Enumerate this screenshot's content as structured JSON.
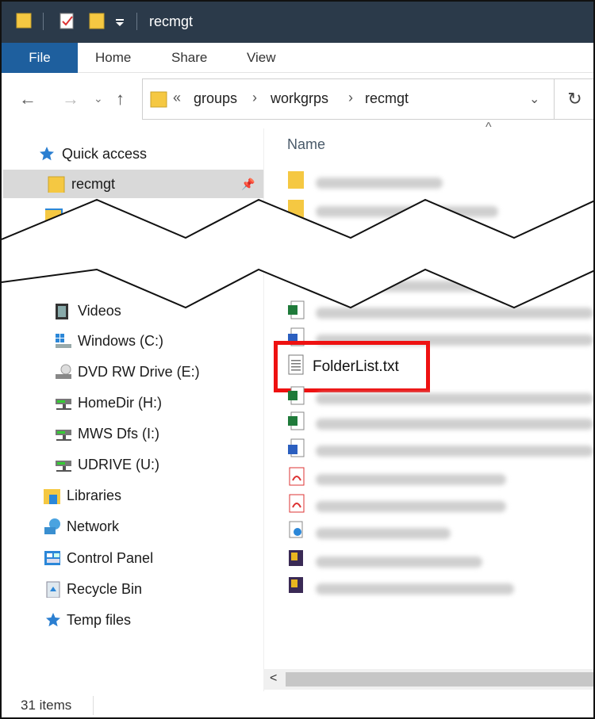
{
  "window": {
    "title": "recmgt"
  },
  "ribbon": {
    "tabs": [
      "File",
      "Home",
      "Share",
      "View"
    ]
  },
  "address": {
    "overflow": "«",
    "crumbs": [
      "groups",
      "workgrps",
      "recmgt"
    ]
  },
  "nav": {
    "quick_access": "Quick access",
    "pinned": "recmgt",
    "items": [
      {
        "label": "Videos",
        "icon": "videos-icon"
      },
      {
        "label": "Windows (C:)",
        "icon": "drive-c-icon"
      },
      {
        "label": "DVD RW Drive (E:)",
        "icon": "dvd-drive-icon"
      },
      {
        "label": "HomeDir (H:)",
        "icon": "network-drive-icon"
      },
      {
        "label": "MWS Dfs (I:)",
        "icon": "network-drive-icon"
      },
      {
        "label": "UDRIVE (U:)",
        "icon": "network-drive-icon"
      },
      {
        "label": "Libraries",
        "icon": "libraries-icon"
      },
      {
        "label": "Network",
        "icon": "network-icon"
      },
      {
        "label": "Control Panel",
        "icon": "control-panel-icon"
      },
      {
        "label": "Recycle Bin",
        "icon": "recycle-bin-icon"
      },
      {
        "label": "Temp files",
        "icon": "star-pin-icon"
      }
    ]
  },
  "filelist": {
    "column_name": "Name",
    "highlighted_file": "FolderList.txt"
  },
  "status": {
    "count": "31 items"
  },
  "colors": {
    "titlebar": "#2b3a4a",
    "file_tab": "#1e5f9e",
    "highlight": "#e11111",
    "folder": "#f5c842"
  }
}
